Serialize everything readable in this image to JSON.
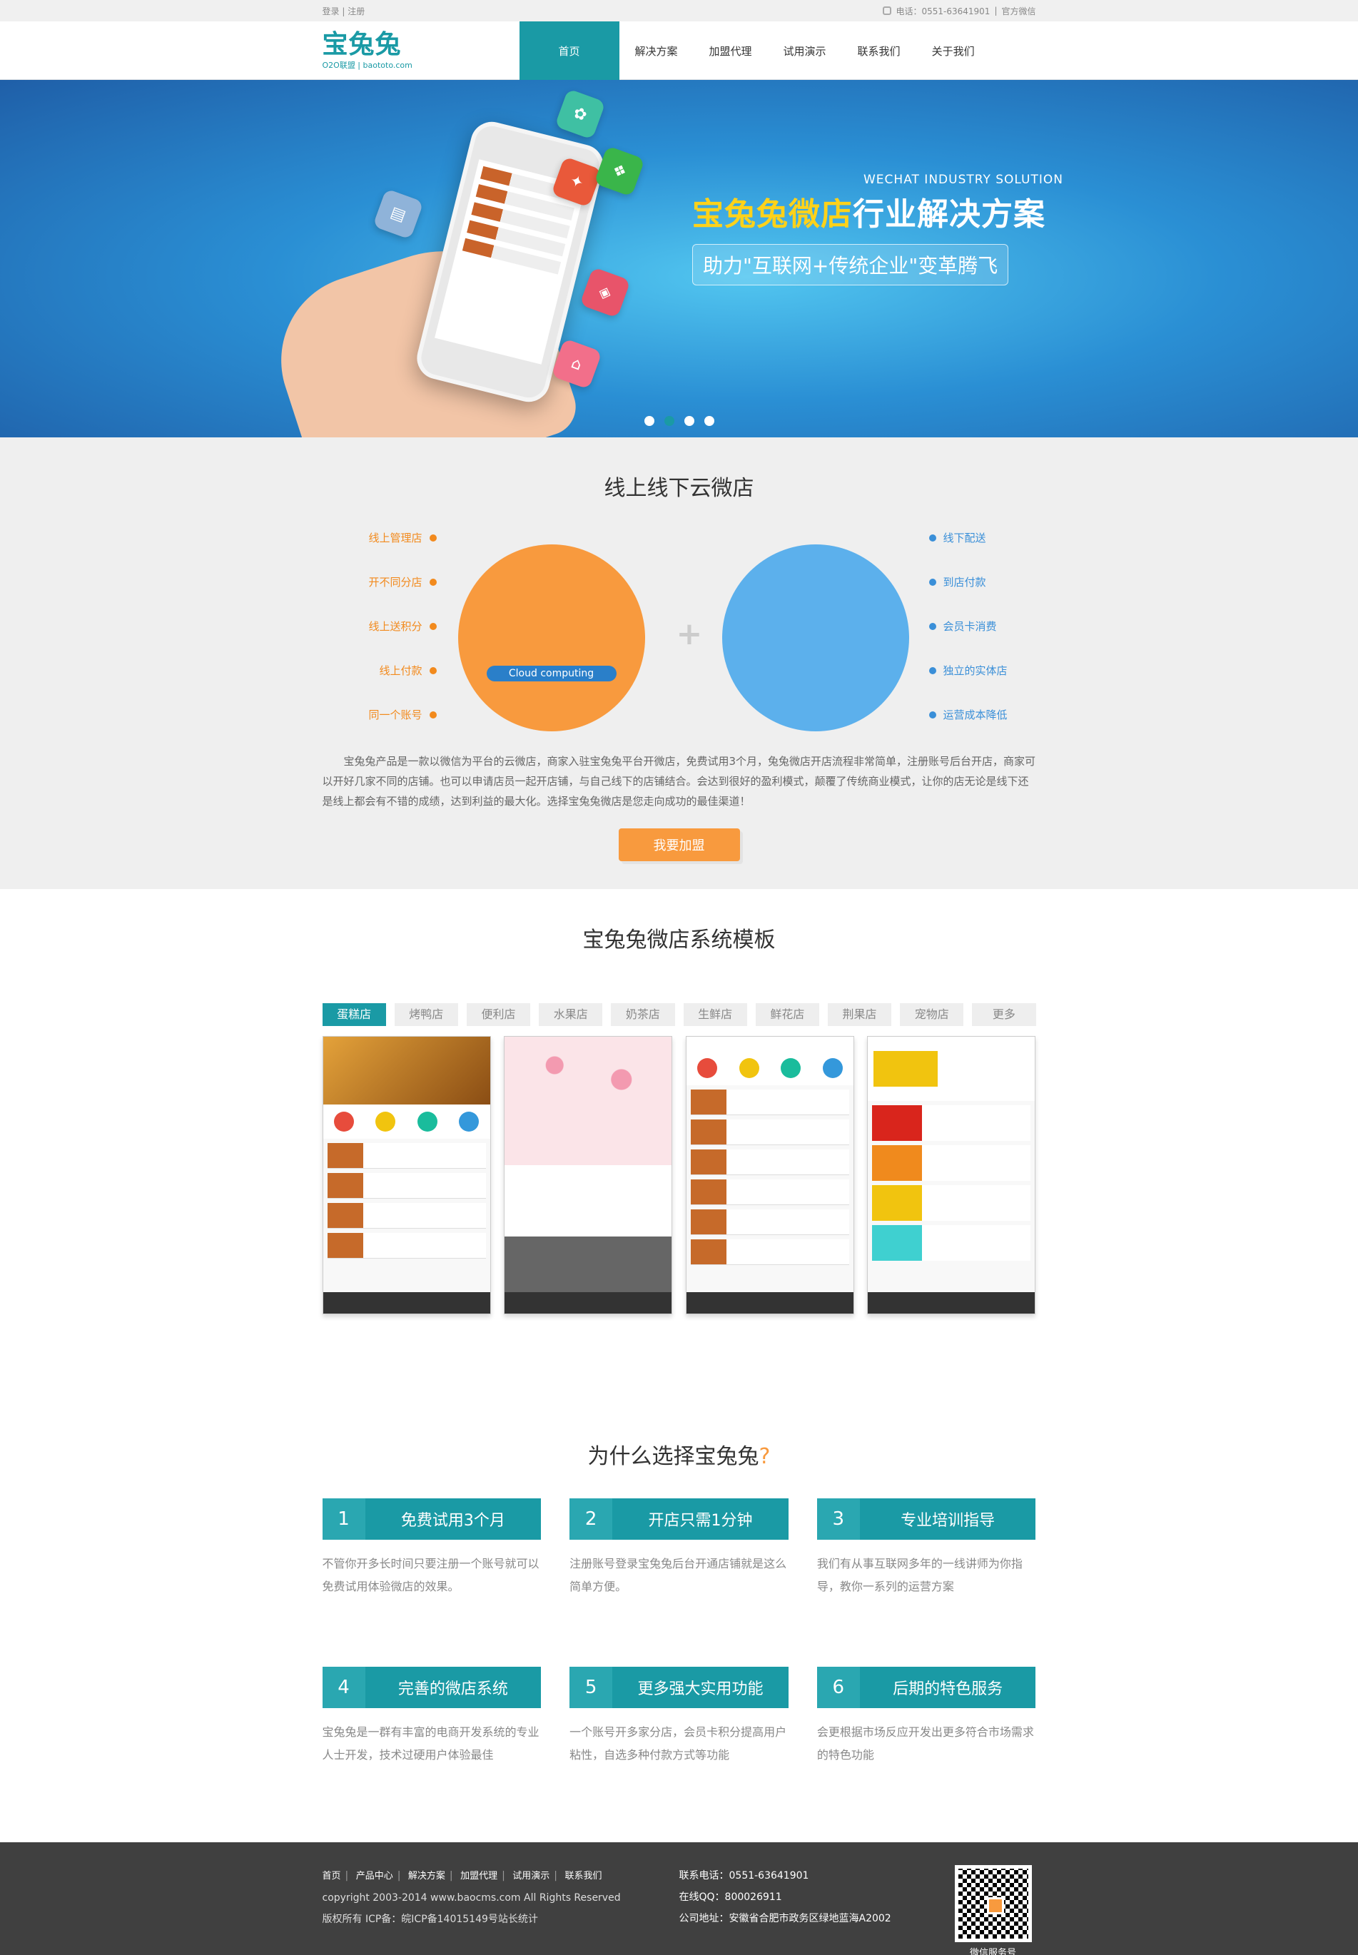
{
  "topbar": {
    "login": "登录",
    "register": "注册",
    "phone": "电话：0551-63641901",
    "wechat": "官方微信"
  },
  "header": {
    "logo_name": "宝兔兔",
    "logo_sub": "O2O联盟 | baototo.com",
    "nav": [
      "首页",
      "解决方案",
      "加盟代理",
      "试用演示",
      "联系我们",
      "关于我们"
    ]
  },
  "banner": {
    "en": "WECHAT INDUSTRY SOLUTION",
    "title_hl": "宝兔兔微店",
    "title_rest": "行业解决方案",
    "slogan": "助力\"互联网+传统企业\"变革腾飞"
  },
  "cloud": {
    "title": "线上线下云微店",
    "left": [
      "线上管理店",
      "开不同分店",
      "线上送积分",
      "线上付款",
      "同一个账号"
    ],
    "right": [
      "线下配送",
      "到店付款",
      "会员卡消费",
      "独立的实体店",
      "运营成本降低"
    ],
    "circle_label": "Cloud computing",
    "desc": "宝兔兔产品是一款以微信为平台的云微店，商家入驻宝兔兔平台开微店，免费试用3个月，兔兔微店开店流程非常简单，注册账号后台开店，商家可以开好几家不同的店铺。也可以申请店员一起开店铺，与自己线下的店铺结合。会达到很好的盈利模式，颠覆了传统商业模式，让你的店无论是线下还是线上都会有不错的成绩，达到利益的最大化。选择宝兔兔微店是您走向成功的最佳渠道！",
    "join": "我要加盟"
  },
  "templates": {
    "title": "宝兔兔微店系统模板",
    "tabs": [
      "蛋糕店",
      "烤鸭店",
      "便利店",
      "水果店",
      "奶茶店",
      "生鲜店",
      "鲜花店",
      "荆果店",
      "宠物店",
      "更多"
    ]
  },
  "why": {
    "title": "为什么选择宝兔兔",
    "q": "?",
    "cards": [
      {
        "num": "1",
        "title": "免费试用3个月",
        "text": "不管你开多长时间只要注册一个账号就可以免费试用体验微店的效果。"
      },
      {
        "num": "2",
        "title": "开店只需1分钟",
        "text": "注册账号登录宝兔兔后台开通店铺就是这么简单方便。"
      },
      {
        "num": "3",
        "title": "专业培训指导",
        "text": "我们有从事互联网多年的一线讲师为你指导，教你一系列的运营方案"
      },
      {
        "num": "4",
        "title": "完善的微店系统",
        "text": "宝兔兔是一群有丰富的电商开发系统的专业人士开发，技术过硬用户体验最佳"
      },
      {
        "num": "5",
        "title": "更多强大实用功能",
        "text": "一个账号开多家分店，会员卡积分提高用户粘性，自选多种付款方式等功能"
      },
      {
        "num": "6",
        "title": "后期的特色服务",
        "text": "会更根据市场反应开发出更多符合市场需求的特色功能"
      }
    ]
  },
  "footer": {
    "links": [
      "首页",
      "产品中心",
      "解决方案",
      "加盟代理",
      "试用演示",
      "联系我们"
    ],
    "copyright": "copyright 2003-2014 www.baocms.com All Rights Reserved",
    "icp": "版权所有 ICP备：皖ICP备14015149号站长统计",
    "phone": "联系电话：0551-63641901",
    "qq": "在线QQ：800026911",
    "address": "公司地址：安徽省合肥市政务区绿地蓝海A2002",
    "qr_label": "微信服务号"
  }
}
